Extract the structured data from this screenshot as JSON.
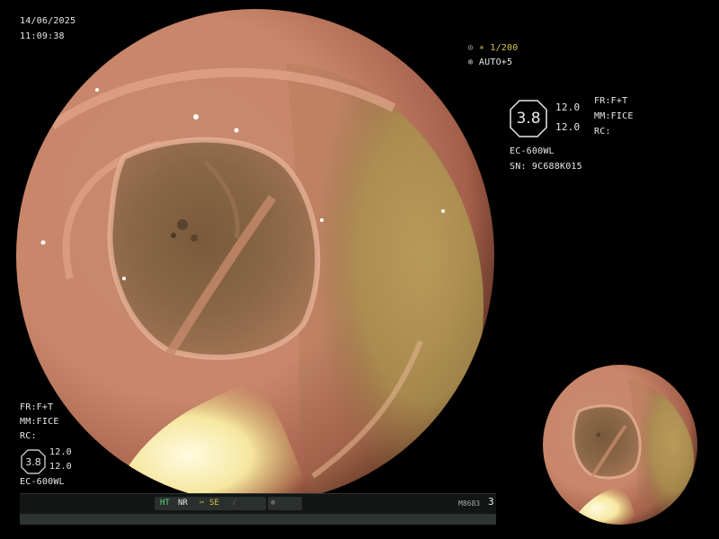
{
  "header": {
    "date": "14/06/2025",
    "time": "11:09:38"
  },
  "capture": {
    "counter_label": "∗ 1/200",
    "auto_label": "AUTO+5"
  },
  "right_panel": {
    "hex_value": "3.8",
    "values": [
      "12.0",
      "12.0"
    ],
    "fr": "FR:F+T",
    "mm": "MM:FICE",
    "rc": "RC:",
    "scope": "EC-600WL",
    "serial": "SN: 9C688K015"
  },
  "left_panel": {
    "fr": "FR:F+T",
    "mm": "MM:FICE",
    "rc": "RC:",
    "hex_value": "3.8",
    "values": [
      "12.0",
      "12.0"
    ],
    "scope": "EC-600WL"
  },
  "status_bar": {
    "ht": "HT",
    "nr": "NR",
    "se": "SE",
    "code": "M8683",
    "count": "3"
  },
  "colors": {
    "accent_yellow": "#d8c24a",
    "status_green": "#5fd37a"
  }
}
